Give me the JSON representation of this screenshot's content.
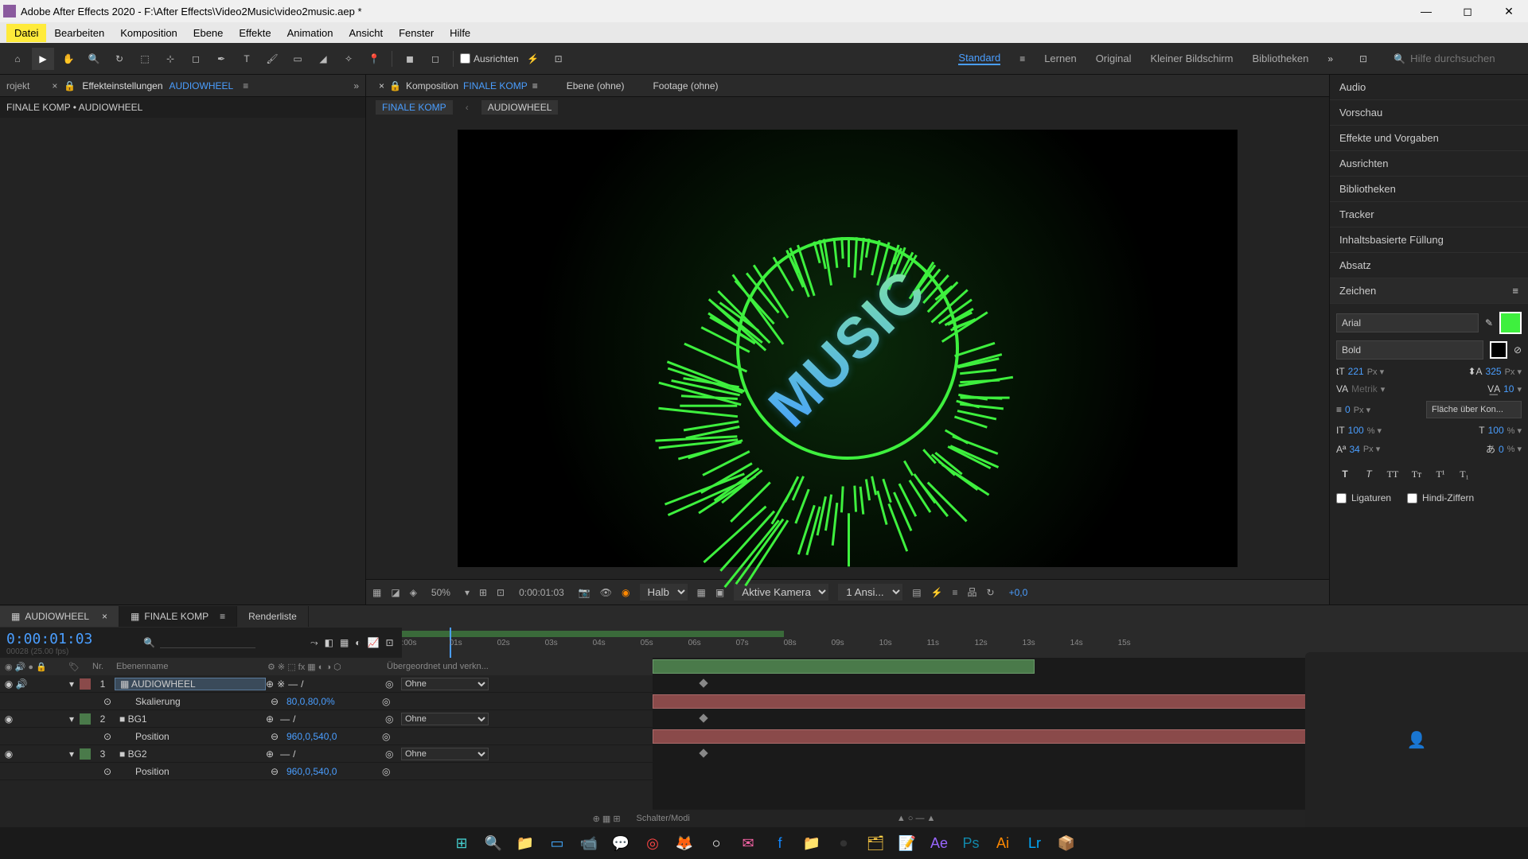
{
  "title_bar": {
    "text": "Adobe After Effects 2020 - F:\\After Effects\\Video2Music\\video2music.aep *"
  },
  "menu": {
    "items": [
      "Datei",
      "Bearbeiten",
      "Komposition",
      "Ebene",
      "Effekte",
      "Animation",
      "Ansicht",
      "Fenster",
      "Hilfe"
    ]
  },
  "toolbar": {
    "ausrichten": "Ausrichten",
    "workspaces": [
      "Standard",
      "Lernen",
      "Original",
      "Kleiner Bildschirm",
      "Bibliotheken"
    ],
    "search_placeholder": "Hilfe durchsuchen"
  },
  "left_panel": {
    "tab_label": "rojekt",
    "eff_label": "Effekteinstellungen",
    "eff_name": "AUDIOWHEEL",
    "breadcrumb": "FINALE KOMP • AUDIOWHEEL"
  },
  "center": {
    "comp_tab_prefix": "Komposition",
    "comp_name": "FINALE KOMP",
    "ebene_tab": "Ebene (ohne)",
    "footage_tab": "Footage (ohne)",
    "crumbs": [
      "FINALE KOMP",
      "AUDIOWHEEL"
    ],
    "music_text": "MUSIC",
    "footer": {
      "zoom": "50%",
      "time": "0:00:01:03",
      "halb": "Halb",
      "camera": "Aktive Kamera",
      "views": "1 Ansi...",
      "exposure": "+0,0"
    }
  },
  "right_panel": {
    "items": [
      "Audio",
      "Vorschau",
      "Effekte und Vorgaben",
      "Ausrichten",
      "Bibliotheken",
      "Tracker",
      "Inhaltsbasierte Füllung",
      "Absatz",
      "Zeichen"
    ],
    "char": {
      "font": "Arial",
      "weight": "Bold",
      "size": "221",
      "leading": "325",
      "kerning": "Metrik",
      "tracking": "10",
      "stroke": "0",
      "fill_over": "Fläche über Kon...",
      "vscale": "100",
      "hscale": "100",
      "baseline": "34",
      "tsume": "0",
      "ligatures": "Ligaturen",
      "hindi": "Hindi-Ziffern"
    }
  },
  "timeline": {
    "tabs": [
      "AUDIOWHEEL",
      "FINALE KOMP",
      "Renderliste"
    ],
    "timecode": "0:00:01:03",
    "fps": "00028 (25.00 fps)",
    "cols": {
      "nr": "Nr.",
      "name": "Ebenenname",
      "parent": "Übergeordnet und verkn..."
    },
    "seconds": [
      ":00s",
      "01s",
      "02s",
      "03s",
      "04s",
      "05s",
      "06s",
      "07s",
      "08s",
      "09s",
      "10s",
      "11s",
      "12s",
      "13s",
      "14s",
      "15s"
    ],
    "layers": [
      {
        "num": "1",
        "color": "#8a4a4a",
        "name": "AUDIOWHEEL",
        "parent": "Ohne",
        "props": [
          {
            "name": "Skalierung",
            "value": "80,0,80,0%"
          }
        ]
      },
      {
        "num": "2",
        "color": "#4a7a4a",
        "name": "BG1",
        "parent": "Ohne",
        "props": [
          {
            "name": "Position",
            "value": "960,0,540,0"
          }
        ]
      },
      {
        "num": "3",
        "color": "#4a7a4a",
        "name": "BG2",
        "parent": "Ohne",
        "props": [
          {
            "name": "Position",
            "value": "960,0,540,0"
          }
        ]
      }
    ],
    "footer": "Schalter/Modi"
  },
  "taskbar": {
    "icons": [
      "⊞",
      "🔍",
      "📁",
      "▭",
      "📹",
      "💬",
      "◎",
      "🦊",
      "○",
      "✉",
      "f",
      "📁",
      "⏺",
      "🗂",
      "📝",
      "Ae",
      "Ps",
      "Ai",
      "Lr",
      "📦"
    ]
  }
}
